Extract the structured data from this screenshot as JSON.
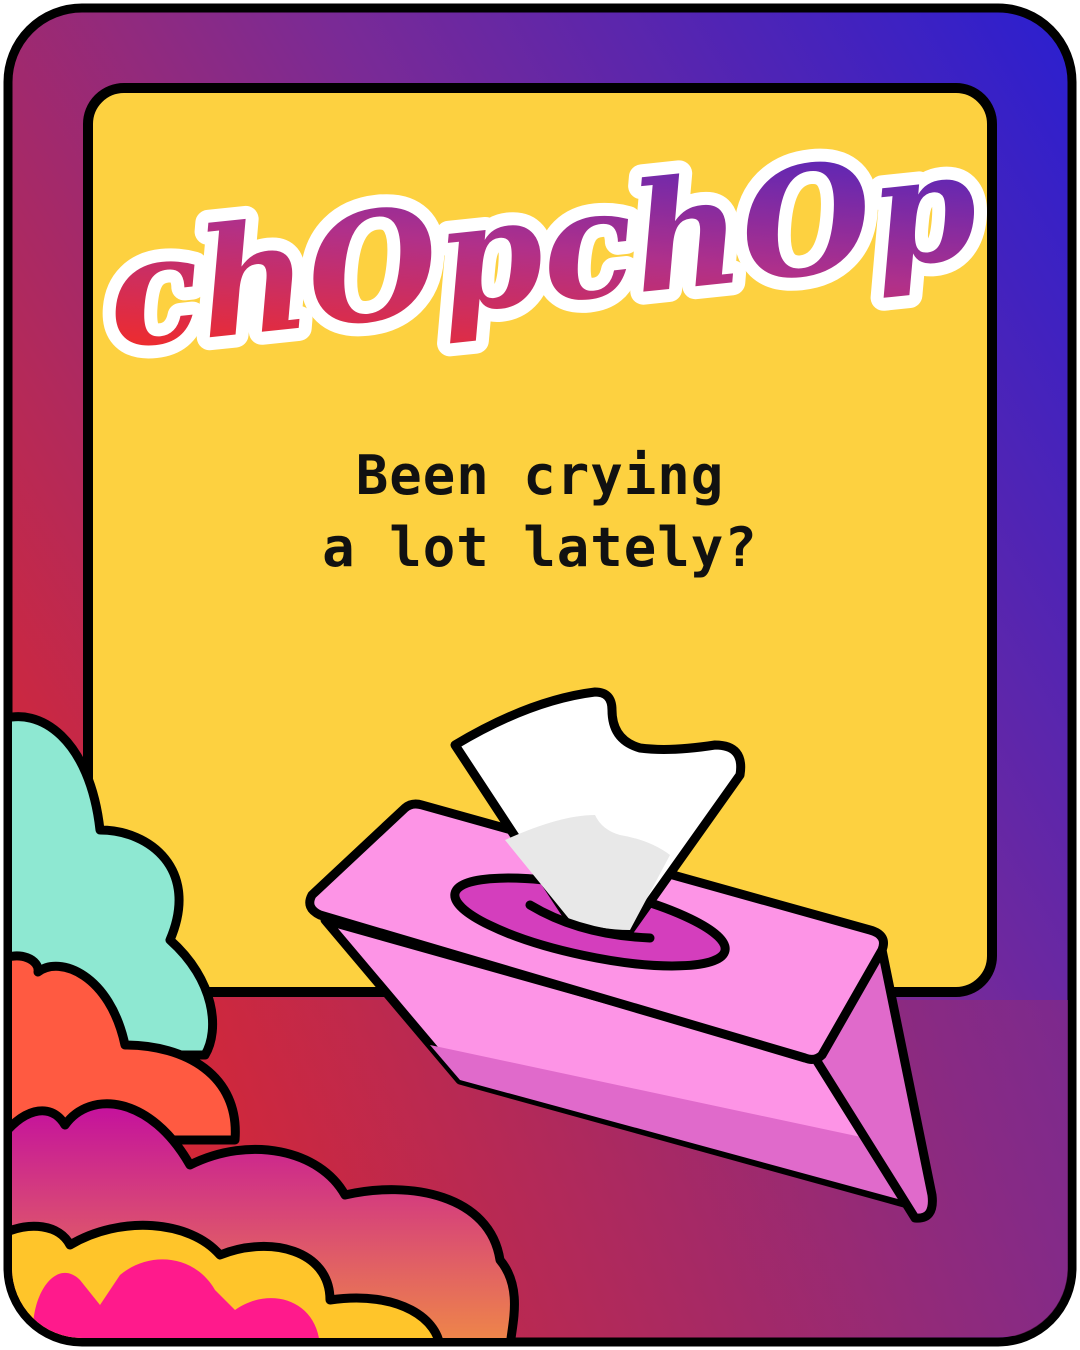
{
  "brand": {
    "logo_text": "chOpchOp"
  },
  "headline": {
    "line1": "Been crying",
    "line2": "a lot lately?"
  },
  "colors": {
    "panel_yellow": "#fdd140",
    "frame_gradient": [
      "#2a1fd0",
      "#7a2a96",
      "#e0282b"
    ],
    "logo_gradient": [
      "#ff2a14",
      "#b0308a",
      "#3a23c8"
    ],
    "tissue_box_pink": "#fd94e6",
    "tissue_box_shade": "#e06acb",
    "tissue_hole": "#d43ebd",
    "cloud_teal": "#8ee8d2",
    "cloud_orange": "#ff5a41",
    "cloud_magenta": "#d0199a",
    "cloud_yellow": "#ffc52a",
    "cloud_pink": "#ff1a8c"
  },
  "icons": [
    "tissue-box-icon",
    "cloud-cluster-icon"
  ]
}
